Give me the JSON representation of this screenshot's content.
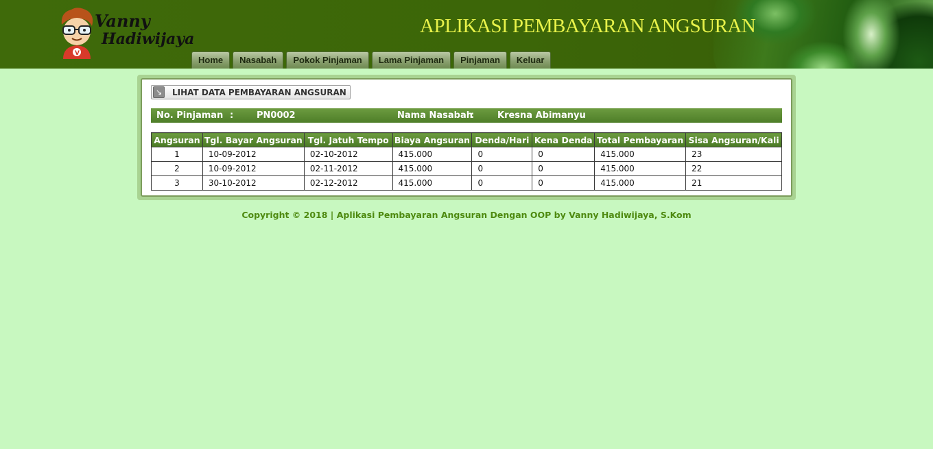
{
  "header": {
    "logo": {
      "line1": "Vanny",
      "line2": "Hadiwijaya"
    },
    "app_title": "APLIKASI PEMBAYARAN ANGSURAN",
    "nav": [
      "Home",
      "Nasabah",
      "Pokok Pinjaman",
      "Lama Pinjaman",
      "Pinjaman",
      "Keluar"
    ]
  },
  "section": {
    "title": "LIHAT DATA PEMBAYARAN ANGSURAN",
    "icon": "arrow-down-right-icon"
  },
  "info": {
    "loan_no_label": "No. Pinjaman",
    "sep1": ":",
    "loan_no_value": "PN0002",
    "customer_label": "Nama Nasabah",
    "sep2": ":",
    "customer_value": "Kresna Abimanyu"
  },
  "table": {
    "headers": [
      "Angsuran",
      "Tgl. Bayar Angsuran",
      "Tgl. Jatuh Tempo",
      "Biaya Angsuran",
      "Denda/Hari",
      "Kena Denda",
      "Total Pembayaran",
      "Sisa Angsuran/Kali"
    ],
    "rows": [
      [
        "1",
        "10-09-2012",
        "02-10-2012",
        "415.000",
        "0",
        "0",
        "415.000",
        "23"
      ],
      [
        "2",
        "10-09-2012",
        "02-11-2012",
        "415.000",
        "0",
        "0",
        "415.000",
        "22"
      ],
      [
        "3",
        "30-10-2012",
        "02-12-2012",
        "415.000",
        "0",
        "0",
        "415.000",
        "21"
      ]
    ]
  },
  "footer": "Copyright © 2018 | Aplikasi Pembayaran Angsuran Dengan OOP by Vanny Hadiwijaya, S.Kom",
  "colors": {
    "background": "#c8f8c0",
    "header_green": "#3c6608",
    "title_yellow": "#e8f24a",
    "footer_green": "#4e8a10"
  }
}
